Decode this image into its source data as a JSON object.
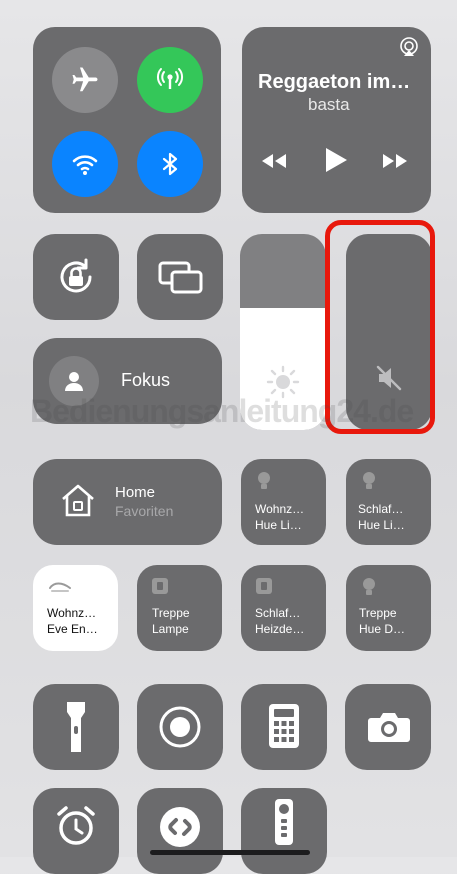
{
  "now_playing": {
    "title": "Reggaeton im…",
    "subtitle": "basta"
  },
  "focus": {
    "label": "Fokus"
  },
  "home": {
    "title": "Home",
    "subtitle": "Favoriten"
  },
  "accessories": [
    {
      "line1": "Wohnz…",
      "line2": "Hue Li…"
    },
    {
      "line1": "Schlaf…",
      "line2": "Hue Li…"
    },
    {
      "line1": "Wohnz…",
      "line2": "Eve En…"
    },
    {
      "line1": "Treppe",
      "line2": "Lampe"
    },
    {
      "line1": "Schlaf…",
      "line2": "Heizde…"
    },
    {
      "line1": "Treppe",
      "line2": "Hue D…"
    }
  ],
  "sliders": {
    "brightness_level": 0.62,
    "volume_level": 0.0
  },
  "watermark": "Bedienungsanleitung24.de",
  "colors": {
    "green": "#34c759",
    "blue": "#0a84ff",
    "highlight": "#e8180c",
    "tile": "#6b6b6d"
  }
}
